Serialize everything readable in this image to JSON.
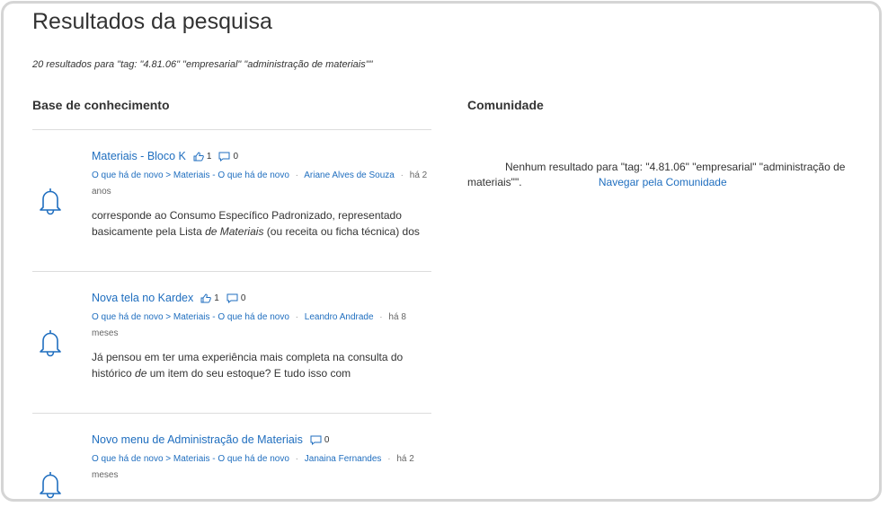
{
  "page": {
    "title": "Resultados da pesquisa",
    "summary": "20 resultados para \"tag: \"4.81.06\" \"empresarial\" \"administração de materiais\"\""
  },
  "knowledge_base": {
    "heading": "Base de conhecimento",
    "results": [
      {
        "title": "Materiais - Bloco K",
        "likes": "1",
        "comments": "0",
        "breadcrumb_1": "O que há de novo",
        "breadcrumb_2": "> Materiais - O que há de novo",
        "author": "Ariane Alves de Souza",
        "time": "há 2 anos",
        "excerpt_before": "corresponde ao Consumo Específico Padronizado, representado basicamente pela Lista ",
        "excerpt_em": "de Materiais",
        "excerpt_after": " (ou receita ou ficha técnica) dos"
      },
      {
        "title": "Nova tela no Kardex",
        "likes": "1",
        "comments": "0",
        "breadcrumb_1": "O que há de novo",
        "breadcrumb_2": "> Materiais - O que há de novo",
        "author": "Leandro Andrade",
        "time": "há 8 meses",
        "excerpt_before": "Já pensou em ter uma experiência mais completa na consulta do histórico ",
        "excerpt_em": "de",
        "excerpt_after": " um item do seu estoque?  E tudo isso com"
      },
      {
        "title": "Novo menu de Administração de Materiais",
        "comments": "0",
        "breadcrumb_1": "O que há de novo",
        "breadcrumb_2": "> Materiais - O que há de novo",
        "author": "Janaina Fernandes",
        "time": "há 2 meses"
      }
    ]
  },
  "community": {
    "heading": "Comunidade",
    "no_results": "Nenhum resultado para \"tag: \"4.81.06\" \"empresarial\" \"administração de materiais\"\".",
    "browse_link": "Navegar pela Comunidade"
  },
  "colors": {
    "link": "#1f6ebf",
    "icon": "#1f6ebf",
    "text": "#333333",
    "divider": "#dcdcdc"
  }
}
